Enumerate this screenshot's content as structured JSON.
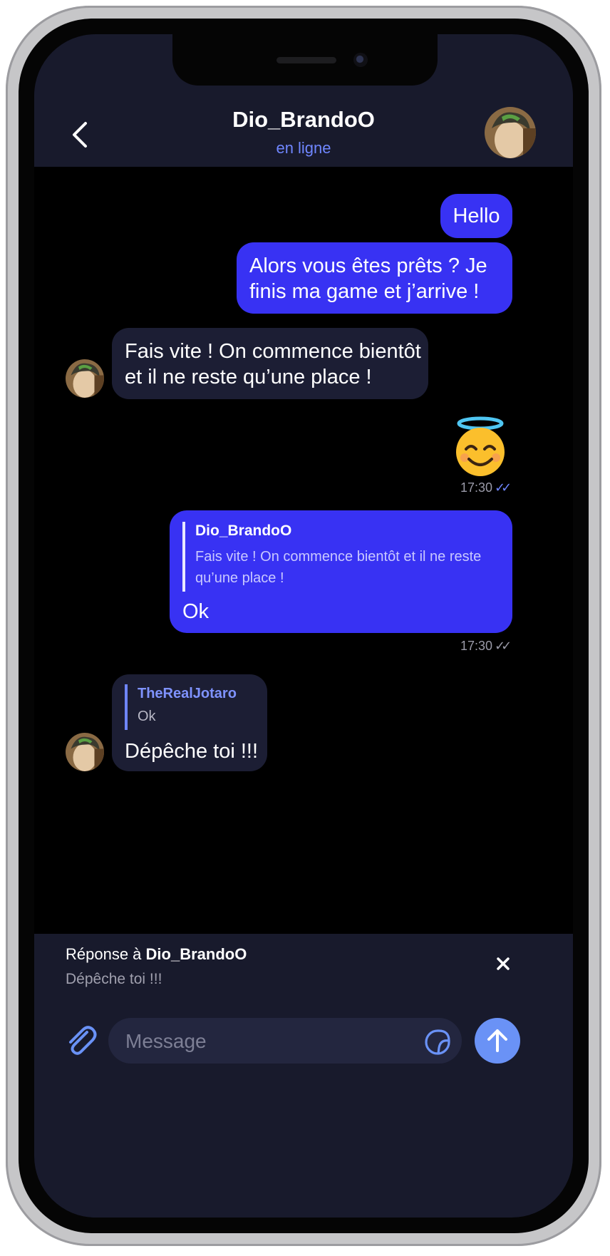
{
  "header": {
    "contact_name": "Dio_BrandoO",
    "status": "en ligne"
  },
  "messages": {
    "m1": {
      "direction": "outgoing",
      "text": "Hello"
    },
    "m2": {
      "direction": "outgoing",
      "line1": "Alors vous êtes prêts ? Je",
      "line2": "finis ma game et j’arrive !"
    },
    "m3": {
      "direction": "incoming",
      "line1": "Fais vite ! On commence bientôt",
      "line2": "et il ne reste qu’une place !"
    },
    "m4": {
      "direction": "outgoing",
      "emoji": "😇",
      "time": "17:30",
      "ticks": "✓✓"
    },
    "m5": {
      "direction": "outgoing",
      "quote_author": "Dio_BrandoO",
      "quote_line1": "Fais vite ! On commence bientôt et il ne reste",
      "quote_line2": "qu’une place !",
      "text": "Ok",
      "time": "17:30",
      "ticks": "✓✓"
    },
    "m6": {
      "direction": "incoming",
      "quote_author": "TheRealJotaro",
      "quote_text": "Ok",
      "text": "Dépêche toi !!!"
    }
  },
  "reply_bar": {
    "prefix": "Réponse à ",
    "author": "Dio_BrandoO",
    "text": "Dépêche toi !!!"
  },
  "composer": {
    "placeholder": "Message"
  },
  "colors": {
    "outgoing_bubble": "#3832f3",
    "incoming_bubble": "#1c1e34",
    "header_bg": "#181a2c",
    "status_accent": "#6f86ff",
    "send_button": "#6a92f6",
    "read_ticks": "#6f86ff"
  },
  "icons": {
    "back": "chevron-left-icon",
    "attach": "paperclip-icon",
    "sticker": "sticker-icon",
    "send": "arrow-up-icon",
    "close": "close-icon"
  }
}
